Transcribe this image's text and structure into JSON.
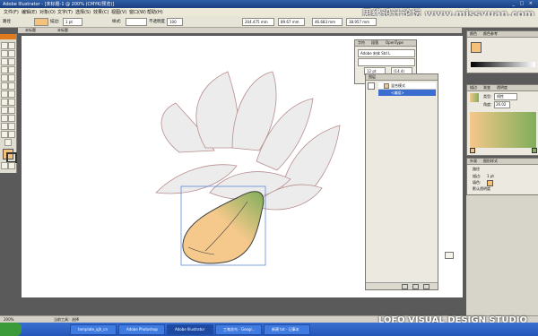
{
  "app": {
    "title": "Adobe Illustrator - [未标题-1 @ 200% (CMYK/预览)]"
  },
  "menu": [
    "文件(F)",
    "编辑(E)",
    "对象(O)",
    "文字(T)",
    "选择(S)",
    "效果(C)",
    "视图(V)",
    "窗口(W)",
    "帮助(H)"
  ],
  "control_bar": {
    "label_path": "路径",
    "label_stroke": "描边:",
    "stroke_weight": "1 pt",
    "label_style": "样式:",
    "label_opacity": "不透明度",
    "opacity_value": "100",
    "x_value": "204.475 mm",
    "y_value": "89.67 mm",
    "w_value": "46.683 mm",
    "h_value": "38.957 mm"
  },
  "doc_tabs": [
    "未标题",
    "未标题"
  ],
  "panels": {
    "top_right": {
      "tabs": [
        "颜色",
        "颜色参考"
      ]
    },
    "gradient": {
      "tabs": [
        "描边",
        "渐变",
        "透明度"
      ],
      "type_label": "类型:",
      "type_value": "线性",
      "angle_label": "角度:",
      "angle_value": "26.02"
    },
    "appearance": {
      "tabs": [
        "外观",
        "图形样式"
      ],
      "item_label": "路径",
      "stroke_label": "描边:",
      "stroke_value": "1 pt",
      "fill_label": "填色:",
      "opacity_label": "默认透明度"
    },
    "character": {
      "tabs": [
        "字符",
        "段落",
        "OpenType"
      ],
      "font_value": "Adobe 宋体 Std L",
      "size_value": "12 pt",
      "leading_value": "(14.4)"
    },
    "layers": {
      "tabs": [
        "图层"
      ],
      "layer_name": "混合模式",
      "sublayer_name": "<编组>"
    }
  },
  "status": {
    "left_text": "200%",
    "middle_text": "当前工具：选择"
  },
  "taskbar": {
    "items": [
      "template_qjh_cn",
      "Adobe Photoshop",
      "Adobe Illustrator",
      "工笔花鸟 - Googl...",
      "新建 txt - 记事本"
    ],
    "active_index": 2
  },
  "watermarks": {
    "top": "思缘设计论坛 www.missyuan.com",
    "bottom": "LOFO VISUAL DESIGN STUDIO"
  },
  "colors": {
    "gradient_start": "#f5c88b",
    "gradient_end": "#7fae5a",
    "petal_fill": "#ececec",
    "petal_stroke": "#b88e8e",
    "selection_blue": "#4a7bd6"
  }
}
